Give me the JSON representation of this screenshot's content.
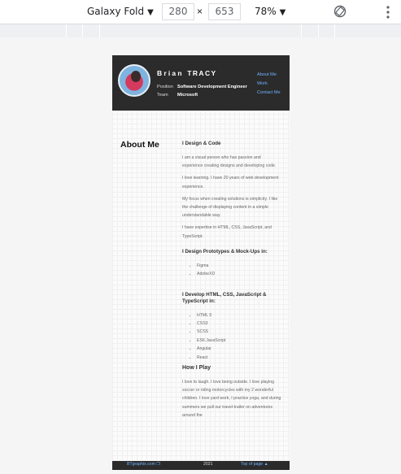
{
  "devtools": {
    "device": "Galaxy Fold",
    "width": "280",
    "height": "653",
    "zoom": "78%",
    "times": "×"
  },
  "site": {
    "name_first": "Brian",
    "name_last": "TRACY",
    "position_label": "Position",
    "position_value": "Software Development Engineer",
    "team_label": "Team",
    "team_value": "Microsoft",
    "nav": [
      "About Me",
      "Work",
      "Contact Me"
    ]
  },
  "about": {
    "title": "About Me",
    "heading1": "I Design & Code",
    "paragraphs": [
      "I am a visual person who has passion and experience creating designs and developing code.",
      "I love learning. I have 20 years of web development experience.",
      "My focus when creating solutions is simplicity. I like the challenge of displaying content in a simple understandable way.",
      "I have expertise in HTML, CSS, JavaScript, and TypeScript."
    ],
    "heading2": "I Design Prototypes & Mock-Ups in:",
    "tools": [
      "Figma",
      "AdobeXD"
    ],
    "heading3": "I Develop HTML, CSS, JavaScript & TypeScript in:",
    "langs": [
      "HTML 5",
      "CSS3",
      "SCSS",
      "ES6 JavaScript",
      "Angular",
      "React"
    ],
    "heading4": "How I Play",
    "play": "I love to laugh. I love being outside. I love playing soccer or riding motorcycles with my 2 wonderful children. I love yard work, I practice yoga, and during summers we pull our travel-trailer on adventures around the"
  },
  "footer": {
    "link": "BTgraphix.com",
    "year": "2021",
    "top": "Top of page"
  }
}
